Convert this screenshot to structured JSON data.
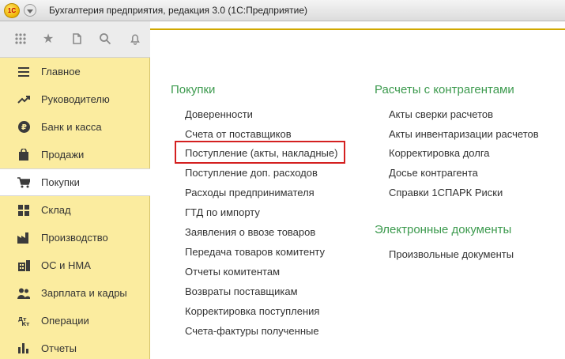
{
  "window": {
    "title": "Бухгалтерия предприятия, редакция 3.0  (1С:Предприятие)",
    "logo_text": "1С"
  },
  "toolbar": {
    "icons": [
      "apps-grid-icon",
      "favorites-star-icon",
      "history-icon",
      "search-icon",
      "notifications-bell-icon"
    ]
  },
  "sidebar": {
    "items": [
      {
        "label": "Главное",
        "icon": "menu-lines-icon"
      },
      {
        "label": "Руководителю",
        "icon": "trend-up-icon"
      },
      {
        "label": "Банк и касса",
        "icon": "ruble-coin-icon"
      },
      {
        "label": "Продажи",
        "icon": "shopping-bag-icon"
      },
      {
        "label": "Покупки",
        "icon": "shopping-cart-icon",
        "active": true
      },
      {
        "label": "Склад",
        "icon": "warehouse-grid-icon"
      },
      {
        "label": "Производство",
        "icon": "factory-icon"
      },
      {
        "label": "ОС и НМА",
        "icon": "building-icon"
      },
      {
        "label": "Зарплата и кадры",
        "icon": "people-icon"
      },
      {
        "label": "Операции",
        "icon": "dt-kt-icon",
        "icon_text": "Дт Кт"
      },
      {
        "label": "Отчеты",
        "icon": "bar-chart-icon"
      }
    ]
  },
  "content": {
    "purchases": {
      "title": "Покупки",
      "links": [
        "Доверенности",
        "Счета от поставщиков",
        "Поступление (акты, накладные)",
        "Поступление доп. расходов",
        "Расходы предпринимателя",
        "ГТД по импорту",
        "Заявления о ввозе товаров",
        "Передача товаров комитенту",
        "Отчеты комитентам",
        "Возвраты поставщикам",
        "Корректировка поступления",
        "Счета-фактуры полученные"
      ]
    },
    "settlements": {
      "title": "Расчеты с контрагентами",
      "links": [
        "Акты сверки расчетов",
        "Акты инвентаризации расчетов",
        "Корректировка долга",
        "Досье контрагента",
        "Справки 1СПАРК Риски"
      ]
    },
    "edocs": {
      "title": "Электронные документы",
      "links": [
        "Произвольные документы"
      ]
    }
  },
  "colors": {
    "sidebar_bg": "#fbec9f",
    "section_title": "#3c9a4e",
    "highlight": "#d42020",
    "accent_line": "#d0a800"
  }
}
